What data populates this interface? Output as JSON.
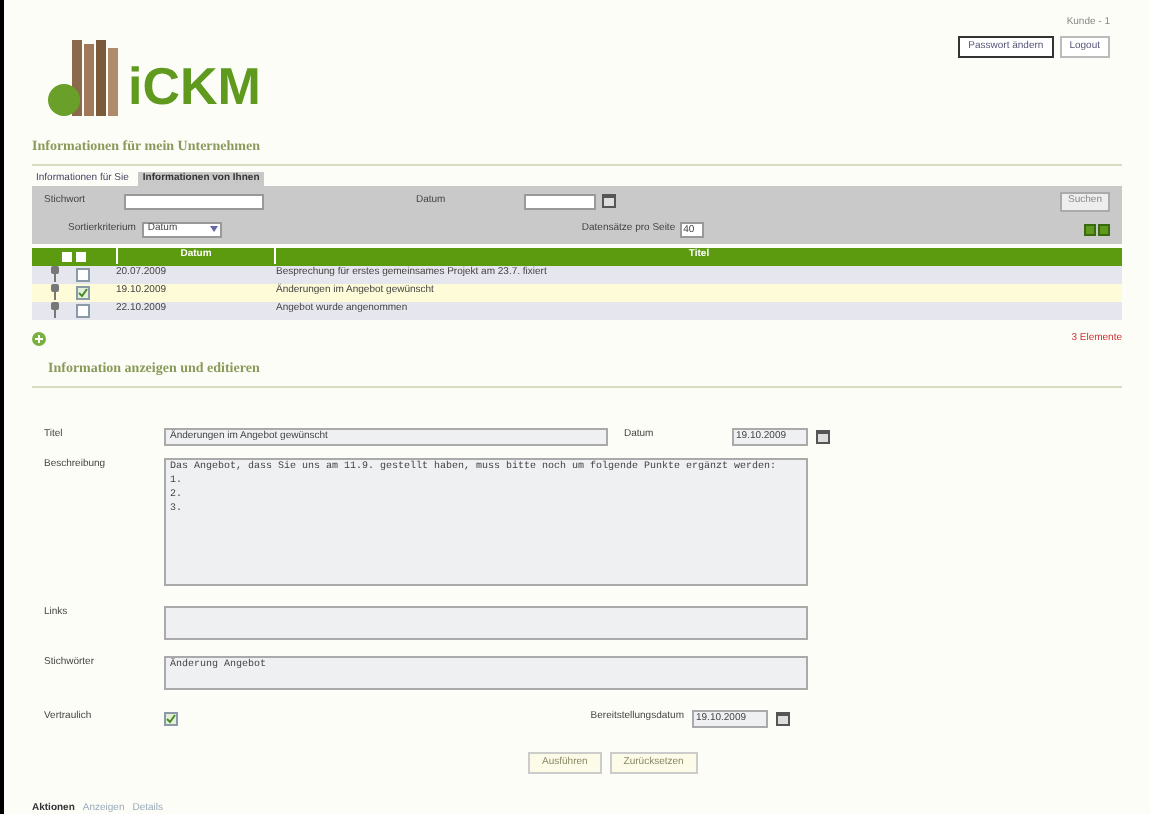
{
  "header": {
    "logo_text": "iCKM",
    "user": "Kunde - 1",
    "links": [
      "Passwort ändern",
      "Logout"
    ]
  },
  "page_title": "Informationen für mein Unternehmen",
  "tabs": [
    {
      "label": "Informationen für Sie",
      "selected": false
    },
    {
      "label": "Informationen von Ihnen",
      "selected": true
    }
  ],
  "filter": {
    "keyword_label": "Stichwort",
    "date_label": "Datum",
    "search_button": "Suchen",
    "sort_label": "Sortierkriterium",
    "sort_value": "Datum",
    "per_page_label": "Datensätze pro Seite",
    "per_page_value": "40"
  },
  "table": {
    "columns": [
      "Datum",
      "Titel"
    ],
    "rows": [
      {
        "date": "20.07.2009",
        "title": "Besprechung für erstes gemeinsames Projekt am 23.7. fixiert",
        "checked": false,
        "selected": false
      },
      {
        "date": "19.10.2009",
        "title": "Änderungen im Angebot gewünscht",
        "checked": true,
        "selected": true
      },
      {
        "date": "22.10.2009",
        "title": "Angebot wurde angenommen",
        "checked": false,
        "selected": false
      }
    ],
    "count": "3 Elemente"
  },
  "form": {
    "title": "Information anzeigen und editieren",
    "title_label": "Titel",
    "title_value": "Änderungen im Angebot gewünscht",
    "date_label": "Datum",
    "date_value": "19.10.2009",
    "description_label": "Beschreibung",
    "description_value": "Das Angebot, dass Sie uns am 11.9. gestellt haben, muss bitte noch um folgende Punkte ergänzt werden:\n1.\n2.\n3.",
    "links_label": "Links",
    "keywords_label": "Stichwörter",
    "keywords_value": "Änderung Angebot",
    "confidential_label": "Vertraulich",
    "confidential": true,
    "provision_label": "Bereitstellungsdatum",
    "provision_value": "19.10.2009",
    "buttons": [
      "Ausführen",
      "Zurücksetzen"
    ]
  },
  "actions": {
    "label": "Aktionen",
    "links": [
      "Anzeigen",
      "Details"
    ]
  }
}
